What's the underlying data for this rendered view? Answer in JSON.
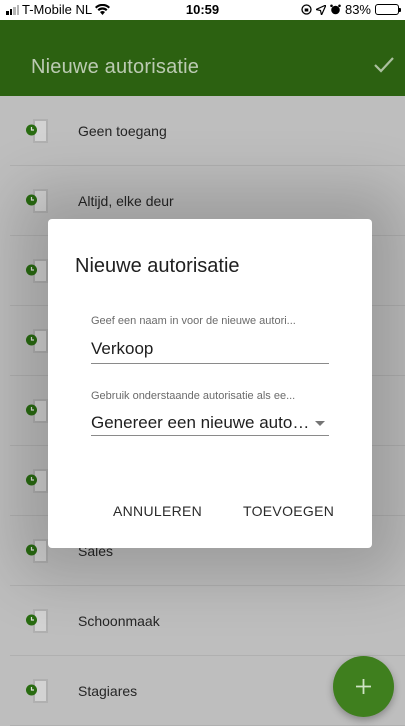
{
  "status_bar": {
    "carrier": "T-Mobile NL",
    "time": "10:59",
    "battery": "83%"
  },
  "app_bar": {
    "title": "Nieuwe autorisatie",
    "icons": {
      "confirm": "check-icon"
    }
  },
  "list": {
    "items": [
      {
        "label": "Geen toegang"
      },
      {
        "label": "Altijd, elke deur"
      },
      {
        "label": ""
      },
      {
        "label": ""
      },
      {
        "label": ""
      },
      {
        "label": ""
      },
      {
        "label": "Sales"
      },
      {
        "label": "Schoonmaak"
      },
      {
        "label": "Stagiares"
      }
    ],
    "icon": "door-icon"
  },
  "dialog": {
    "title": "Nieuwe autorisatie",
    "name_field": {
      "label": "Geef een naam in voor de nieuwe autori...",
      "value": "Verkoop"
    },
    "base_select": {
      "label": "Gebruik onderstaande autorisatie als ee...",
      "value": "Genereer een nieuwe autor..."
    },
    "cancel_label": "ANNULEREN",
    "add_label": "TOEVOEGEN"
  },
  "fab": {
    "icon": "plus-icon"
  },
  "colors": {
    "app_bar": "#336f14",
    "fab": "#3f7f1e",
    "icon_accent": "#2f7b14"
  }
}
